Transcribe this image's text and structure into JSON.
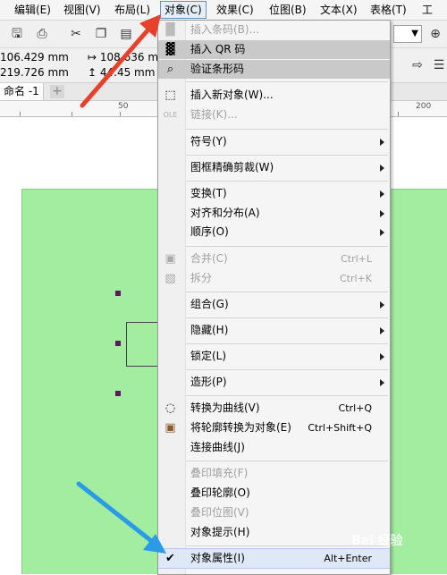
{
  "menubar": {
    "items": [
      "编辑(E)",
      "视图(V)",
      "布局(L)",
      "对象(C)",
      "效果(C)",
      "位图(B)",
      "文本(X)",
      "表格(T)",
      "工"
    ],
    "active_index": 3
  },
  "propbar": {
    "x": "106.429 mm",
    "y": "219.726 mm",
    "w": "108.636 mm",
    "h": "44.45 mm"
  },
  "tab": {
    "name": "命名 -1",
    "add": "+"
  },
  "ruler": {
    "labels": [
      "50",
      "200"
    ]
  },
  "menu": {
    "items": [
      {
        "label": "插入条码(B)...",
        "disabled": true,
        "icon": "barcode-icon"
      },
      {
        "label": "插入 QR 码",
        "highlight": true,
        "icon": "qr-code-icon"
      },
      {
        "label": "验证条形码",
        "highlight": true,
        "icon": "magnifier-icon"
      },
      {
        "label": "插入新对象(W)...",
        "icon": "insert-object-icon"
      },
      {
        "label": "链接(K)...",
        "disabled": true,
        "icon": "ole-icon"
      },
      {
        "label": "符号(Y)",
        "submenu": true
      },
      {
        "label": "图框精确剪裁(W)",
        "submenu": true
      },
      {
        "label": "变换(T)",
        "submenu": true
      },
      {
        "label": "对齐和分布(A)",
        "submenu": true
      },
      {
        "label": "顺序(O)",
        "submenu": true
      },
      {
        "label": "合并(C)",
        "shortcut": "Ctrl+L",
        "disabled": true,
        "icon": "combine-icon"
      },
      {
        "label": "拆分",
        "shortcut": "Ctrl+K",
        "disabled": true,
        "icon": "break-apart-icon"
      },
      {
        "label": "组合(G)",
        "submenu": true
      },
      {
        "label": "隐藏(H)",
        "submenu": true
      },
      {
        "label": "锁定(L)",
        "submenu": true
      },
      {
        "label": "造形(P)",
        "submenu": true
      },
      {
        "label": "转换为曲线(V)",
        "shortcut": "Ctrl+Q",
        "icon": "convert-curves-icon"
      },
      {
        "label": "将轮廓转换为对象(E)",
        "shortcut": "Ctrl+Shift+Q",
        "icon": "outline-object-icon"
      },
      {
        "label": "连接曲线(J)"
      },
      {
        "label": "叠印填充(F)",
        "disabled": true
      },
      {
        "label": "叠印轮廓(O)"
      },
      {
        "label": "叠印位图(V)",
        "disabled": true
      },
      {
        "label": "对象提示(H)"
      },
      {
        "label": "对象属性(I)",
        "shortcut": "Alt+Enter",
        "checked": true,
        "hover": true
      }
    ]
  },
  "watermark": "Bai 经验",
  "colors": {
    "page": "#a3eda0",
    "arrow_red": "#e8412b",
    "arrow_blue": "#2a9be6"
  }
}
